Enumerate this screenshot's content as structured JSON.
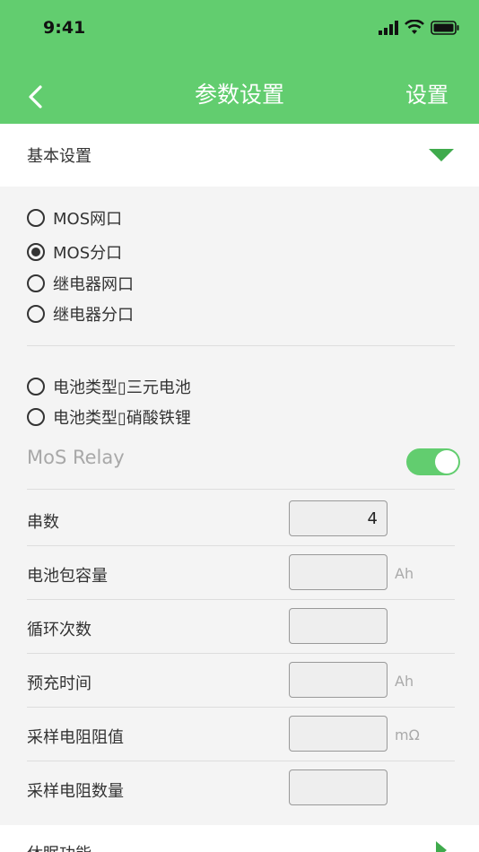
{
  "status_bar": {
    "time": "9:41"
  },
  "nav": {
    "title": "参数设置",
    "action": "设置"
  },
  "basic_section": {
    "title": "基本设置"
  },
  "port_options": [
    {
      "label": "MOS网口",
      "selected": false
    },
    {
      "label": "MOS分口",
      "selected": true
    },
    {
      "label": "继电器网口",
      "selected": false
    },
    {
      "label": "继电器分口",
      "selected": false
    }
  ],
  "battery_options": [
    {
      "label": "电池类型▯三元电池",
      "selected": false
    },
    {
      "label": "电池类型▯硝酸铁锂",
      "selected": false
    }
  ],
  "mos_relay": {
    "label": "MoS Relay",
    "enabled": true
  },
  "fields": [
    {
      "label": "串数",
      "value": "4",
      "unit": ""
    },
    {
      "label": "电池包容量",
      "value": "",
      "unit": "Ah"
    },
    {
      "label": "循环次数",
      "value": "",
      "unit": ""
    },
    {
      "label": "预充时间",
      "value": "",
      "unit": "Ah"
    },
    {
      "label": "采样电阻阻值",
      "value": "",
      "unit": "mΩ"
    },
    {
      "label": "采样电阻数量",
      "value": "",
      "unit": ""
    }
  ],
  "sleep_section": {
    "title": "休眠功能"
  },
  "colors": {
    "brand_green": "#62cd6f",
    "accent_green": "#3faa4c"
  }
}
